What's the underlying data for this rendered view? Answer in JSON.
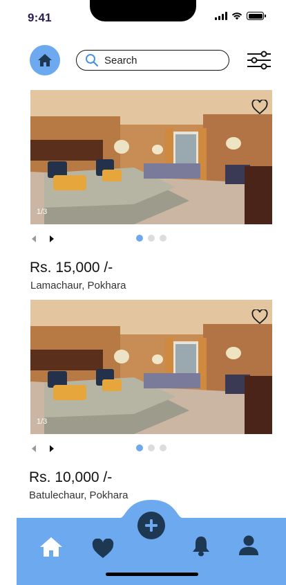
{
  "status_bar": {
    "time": "9:41"
  },
  "header": {
    "home_icon": "home-icon",
    "search_placeholder": "Search",
    "filter_icon": "sliders-icon"
  },
  "colors": {
    "accent": "#6da9ee",
    "nav_background": "#6da9ee",
    "add_button": "#1e3752",
    "dot_inactive": "#dcdcdc"
  },
  "listings": [
    {
      "image_counter": "1/3",
      "price": "Rs. 15,000 /-",
      "location": "Lamachaur, Pokhara",
      "dots_total": 3,
      "active_dot": 0
    },
    {
      "image_counter": "1/3",
      "price": "Rs. 10,000 /-",
      "location": "Batulechaur, Pokhara",
      "dots_total": 3,
      "active_dot": 0
    }
  ],
  "bottom_nav": {
    "items": [
      "home-icon",
      "heart-icon",
      "add-icon",
      "bell-icon",
      "user-icon"
    ]
  }
}
